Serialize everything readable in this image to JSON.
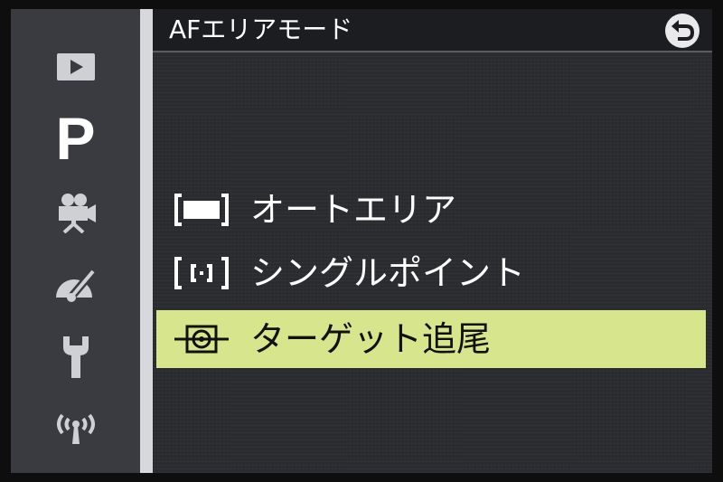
{
  "header": {
    "title": "AFエリアモード",
    "back_icon": "return-icon"
  },
  "sidebar": {
    "items": [
      {
        "icon": "playback-icon"
      },
      {
        "icon": "shooting-mode-icon",
        "label": "P",
        "active": true
      },
      {
        "icon": "movie-camera-icon"
      },
      {
        "icon": "retouch-icon"
      },
      {
        "icon": "wrench-setup-icon"
      },
      {
        "icon": "wireless-icon"
      }
    ]
  },
  "menu": {
    "items": [
      {
        "label": "オートエリア",
        "icon": "auto-area-bracket-icon",
        "selected": false
      },
      {
        "label": "シングルポイント",
        "icon": "single-point-bracket-icon",
        "selected": false
      },
      {
        "label": "ターゲット追尾",
        "icon": "target-tracking-icon",
        "selected": true
      }
    ]
  },
  "colors": {
    "highlight": "#d7e68d",
    "panel": "#2b2c30",
    "sidebar": "#3a3b40",
    "divider": "#d7d8dc"
  }
}
